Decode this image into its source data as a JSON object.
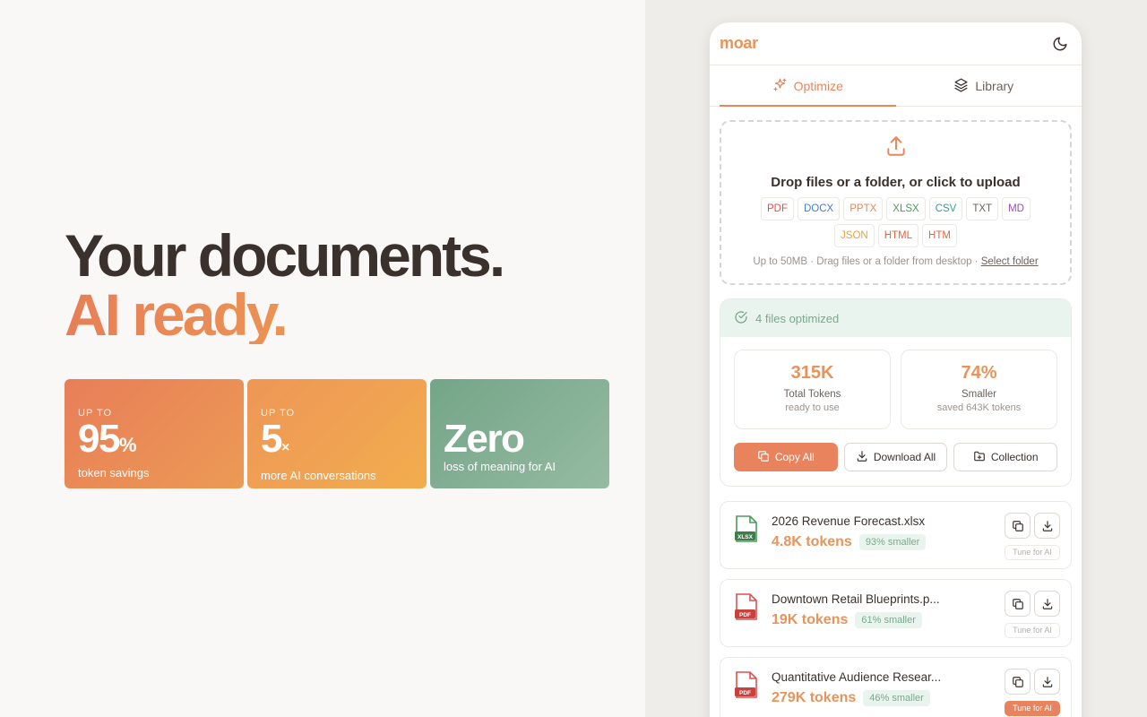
{
  "hero": {
    "headline_line1": "Your documents.",
    "headline_line2": "AI ready.",
    "stats": [
      {
        "upto": "UP TO",
        "value": "95",
        "unit": "%",
        "desc": "token savings"
      },
      {
        "upto": "UP TO",
        "value": "5",
        "unit": "×",
        "desc": "more AI conversations"
      },
      {
        "upto": "",
        "value": "Zero",
        "unit": "",
        "desc": "loss of meaning for AI"
      }
    ]
  },
  "app": {
    "logo": "moar",
    "tabs": [
      {
        "label": "Optimize",
        "icon": "sparkles-icon",
        "active": true
      },
      {
        "label": "Library",
        "icon": "layers-icon",
        "active": false
      }
    ],
    "upload": {
      "title": "Drop files or a folder, or click to upload",
      "formats": [
        {
          "label": "PDF",
          "color": "#d9534f"
        },
        {
          "label": "DOCX",
          "color": "#4a7fc8"
        },
        {
          "label": "PPTX",
          "color": "#e8865a"
        },
        {
          "label": "XLSX",
          "color": "#4d9a5b"
        },
        {
          "label": "CSV",
          "color": "#3f9a8c"
        },
        {
          "label": "TXT",
          "color": "#6b625d"
        },
        {
          "label": "MD",
          "color": "#9a4fb5"
        },
        {
          "label": "JSON",
          "color": "#e9a23b"
        },
        {
          "label": "HTML",
          "color": "#e0663f"
        },
        {
          "label": "HTM",
          "color": "#e0663f"
        }
      ],
      "hint_prefix": "Up to 50MB · Drag files or a folder from desktop · ",
      "hint_link": "Select folder"
    },
    "results": {
      "header": "4 files optimized",
      "metrics": [
        {
          "value": "315K",
          "label": "Total Tokens",
          "sub": "ready to use"
        },
        {
          "value": "74%",
          "label": "Smaller",
          "sub": "saved 643K tokens"
        }
      ],
      "actions": {
        "copy_all": "Copy All",
        "download_all": "Download All",
        "collection": "Collection"
      }
    },
    "files": [
      {
        "name": "2026 Revenue Forecast.xlsx",
        "type": "XLSX",
        "tokens": "4.8K tokens",
        "pct": "93% smaller",
        "tune": "Tune for AI",
        "tune_active": false
      },
      {
        "name": "Downtown Retail Blueprints.p...",
        "type": "PDF",
        "tokens": "19K tokens",
        "pct": "61% smaller",
        "tune": "Tune for AI",
        "tune_active": false
      },
      {
        "name": "Quantitative Audience Resear...",
        "type": "PDF",
        "tokens": "279K tokens",
        "pct": "46% smaller",
        "tune": "Tune for AI",
        "tune_active": true
      }
    ]
  }
}
